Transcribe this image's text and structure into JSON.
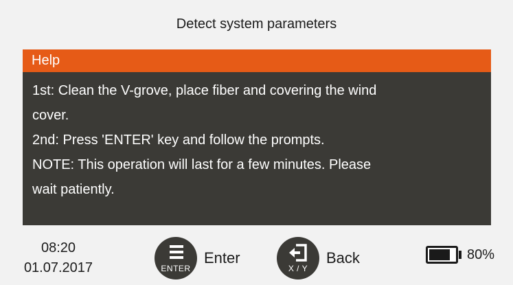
{
  "screen": {
    "title": "Detect system parameters"
  },
  "help": {
    "header": "Help",
    "lines": [
      "1st: Clean the V-grove, place fiber and covering the wind",
      "cover.",
      "2nd: Press 'ENTER' key and follow the prompts.",
      "NOTE: This operation will last for a few minutes. Please",
      "wait patiently."
    ]
  },
  "footer": {
    "time": "08:20",
    "date": "01.07.2017",
    "enter": {
      "icon": "menu-lines-icon",
      "caption": "ENTER",
      "label": "Enter"
    },
    "back": {
      "icon": "exit-arrow-icon",
      "caption": "X / Y",
      "label": "Back"
    },
    "battery": {
      "icon": "battery-icon",
      "level": 0.8,
      "label": "80%"
    }
  },
  "colors": {
    "accent": "#e65b17",
    "panel": "#3b3a36",
    "background": "#f2f2f2"
  }
}
